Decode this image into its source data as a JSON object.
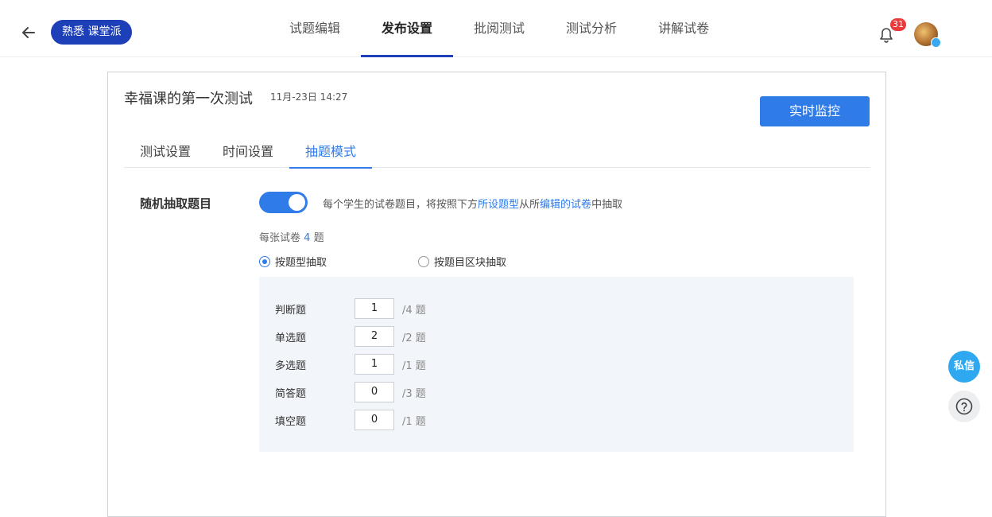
{
  "header": {
    "brand": "熟悉 课堂派",
    "tabs": [
      {
        "label": "试题编辑"
      },
      {
        "label": "发布设置"
      },
      {
        "label": "批阅测试"
      },
      {
        "label": "测试分析"
      },
      {
        "label": "讲解试卷"
      }
    ],
    "notification_count": "31"
  },
  "test": {
    "title": "幸福课的第一次测试",
    "time": "11月-23日 14:27",
    "monitor_label": "实时监控"
  },
  "subtabs": [
    {
      "label": "测试设置"
    },
    {
      "label": "时间设置"
    },
    {
      "label": "抽题模式"
    }
  ],
  "random": {
    "label": "随机抽取题目",
    "enabled": true,
    "desc_prefix": "每个学生的试卷题目，将按照下方",
    "desc_link1": "所设题型",
    "desc_mid": "从所",
    "desc_link2": "编辑的试卷",
    "desc_suffix": "中抽取",
    "per_paper_prefix": "每张试卷",
    "per_paper_count": "4",
    "per_paper_suffix": "题",
    "mode_by_type": "按题型抽取",
    "mode_by_block": "按题目区块抽取"
  },
  "question_types": [
    {
      "name": "判断题",
      "value": "1",
      "total": "/4 题"
    },
    {
      "name": "单选题",
      "value": "2",
      "total": "/2 题"
    },
    {
      "name": "多选题",
      "value": "1",
      "total": "/1 题"
    },
    {
      "name": "简答题",
      "value": "0",
      "total": "/3 题"
    },
    {
      "name": "填空题",
      "value": "0",
      "total": "/1 题"
    }
  ],
  "floating": {
    "message_label": "私信"
  },
  "colors": {
    "primary": "#2f7be8",
    "brand": "#1d3fb8",
    "badge": "#e93b3b"
  }
}
